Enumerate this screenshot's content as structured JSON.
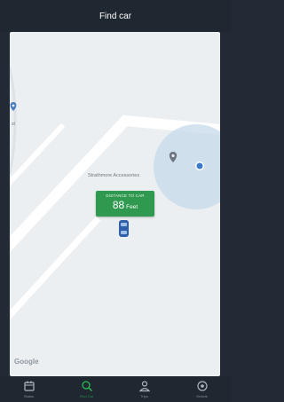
{
  "header": {
    "title": "Find car"
  },
  "map": {
    "place_label": "Strathmore Accessories",
    "edge_label": "st",
    "attribution": "Google",
    "distance": {
      "caption": "DISTANCE TO CAR",
      "value": "88",
      "unit": "Feet"
    }
  },
  "nav": {
    "items": [
      {
        "label": "Status",
        "icon": "calendar-icon",
        "active": false
      },
      {
        "label": "Find Car",
        "icon": "search-icon",
        "active": true
      },
      {
        "label": "Trips",
        "icon": "person-icon",
        "active": false
      },
      {
        "label": "Vehicle",
        "icon": "settings-icon",
        "active": false
      }
    ]
  },
  "colors": {
    "accent": "#2bbd52",
    "badge": "#2f9a4f",
    "bar": "#1f2731",
    "map_bg": "#eceff1"
  }
}
